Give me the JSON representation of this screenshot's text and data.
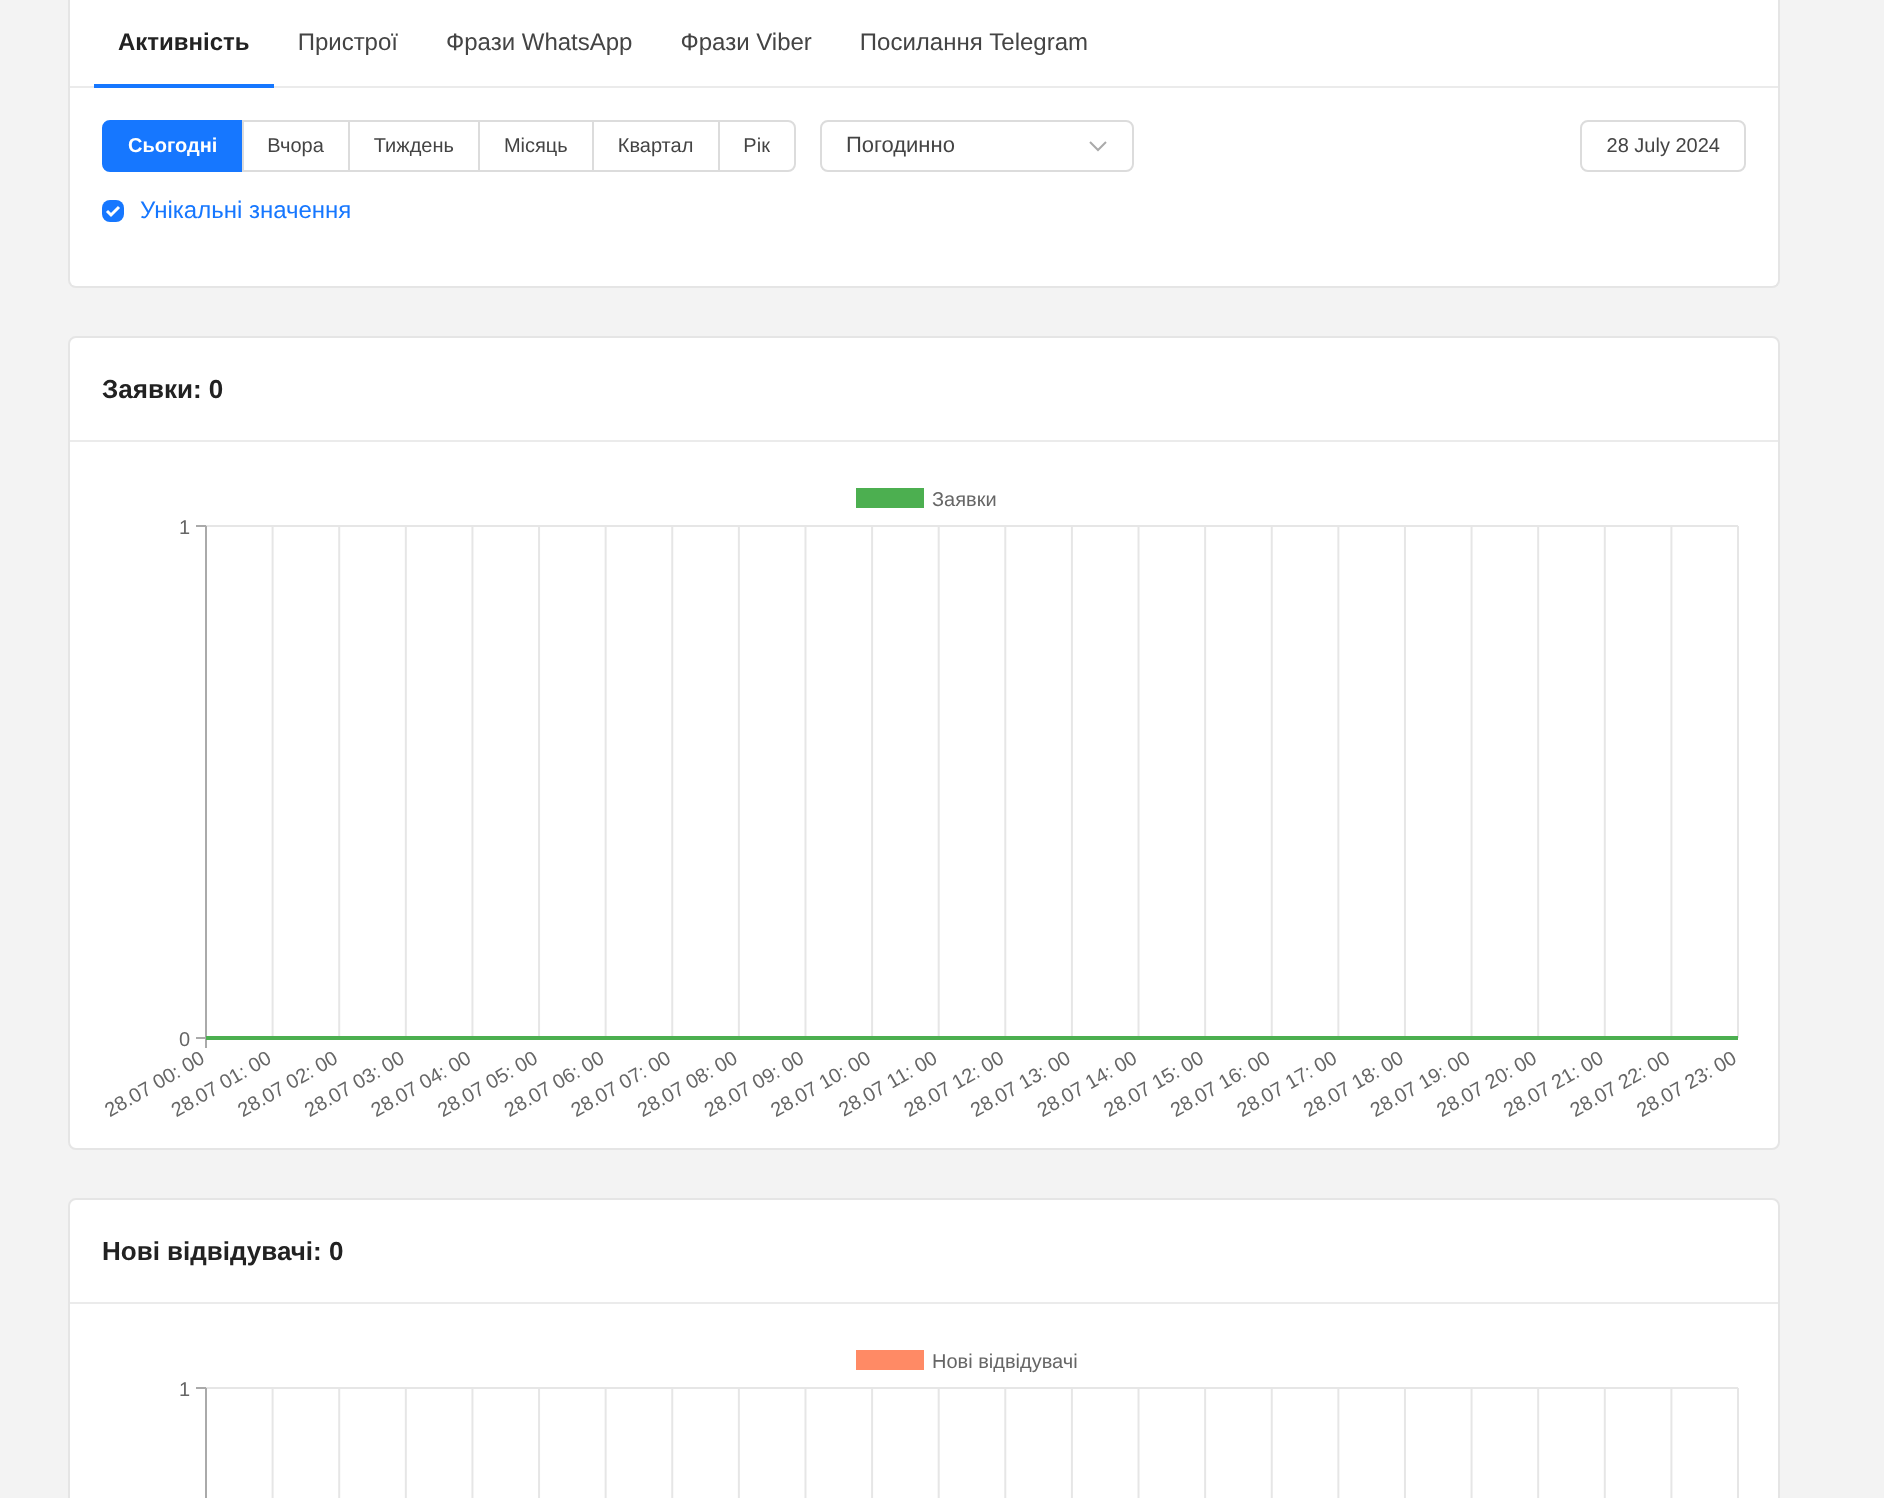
{
  "tabs": [
    {
      "label": "Активність",
      "selected": true
    },
    {
      "label": "Пристрої",
      "selected": false
    },
    {
      "label": "Фрази WhatsApp",
      "selected": false
    },
    {
      "label": "Фрази Viber",
      "selected": false
    },
    {
      "label": "Посилання Telegram",
      "selected": false
    }
  ],
  "periods": [
    {
      "label": "Сьогодні",
      "selected": true
    },
    {
      "label": "Вчора",
      "selected": false
    },
    {
      "label": "Тиждень",
      "selected": false
    },
    {
      "label": "Місяць",
      "selected": false
    },
    {
      "label": "Квартал",
      "selected": false
    },
    {
      "label": "Рік",
      "selected": false
    }
  ],
  "grouping_select": {
    "value": "Погодинно"
  },
  "date_button": "28 July 2024",
  "unique_values": {
    "label": "Унікальні значення",
    "checked": true
  },
  "cards": [
    {
      "title": "Заявки: 0",
      "chart_data": {
        "type": "line",
        "categories": [
          "28.07 00: 00",
          "28.07 01: 00",
          "28.07 02: 00",
          "28.07 03: 00",
          "28.07 04: 00",
          "28.07 05: 00",
          "28.07 06: 00",
          "28.07 07: 00",
          "28.07 08: 00",
          "28.07 09: 00",
          "28.07 10: 00",
          "28.07 11: 00",
          "28.07 12: 00",
          "28.07 13: 00",
          "28.07 14: 00",
          "28.07 15: 00",
          "28.07 16: 00",
          "28.07 17: 00",
          "28.07 18: 00",
          "28.07 19: 00",
          "28.07 20: 00",
          "28.07 21: 00",
          "28.07 22: 00",
          "28.07 23: 00"
        ],
        "series": [
          {
            "name": "Заявки",
            "color": "#4caf50",
            "values": [
              0,
              0,
              0,
              0,
              0,
              0,
              0,
              0,
              0,
              0,
              0,
              0,
              0,
              0,
              0,
              0,
              0,
              0,
              0,
              0,
              0,
              0,
              0,
              0
            ]
          }
        ],
        "ylim": [
          0,
          1
        ],
        "yticks": [
          0,
          1
        ],
        "grid": true
      }
    },
    {
      "title": "Нові відвідувачі: 0",
      "chart_data": {
        "type": "other",
        "series": [
          {
            "name": "Нові відвідувачі",
            "color": "#ff8a65"
          }
        ],
        "annotations": [
          {
            "text": "1"
          }
        ]
      }
    }
  ]
}
